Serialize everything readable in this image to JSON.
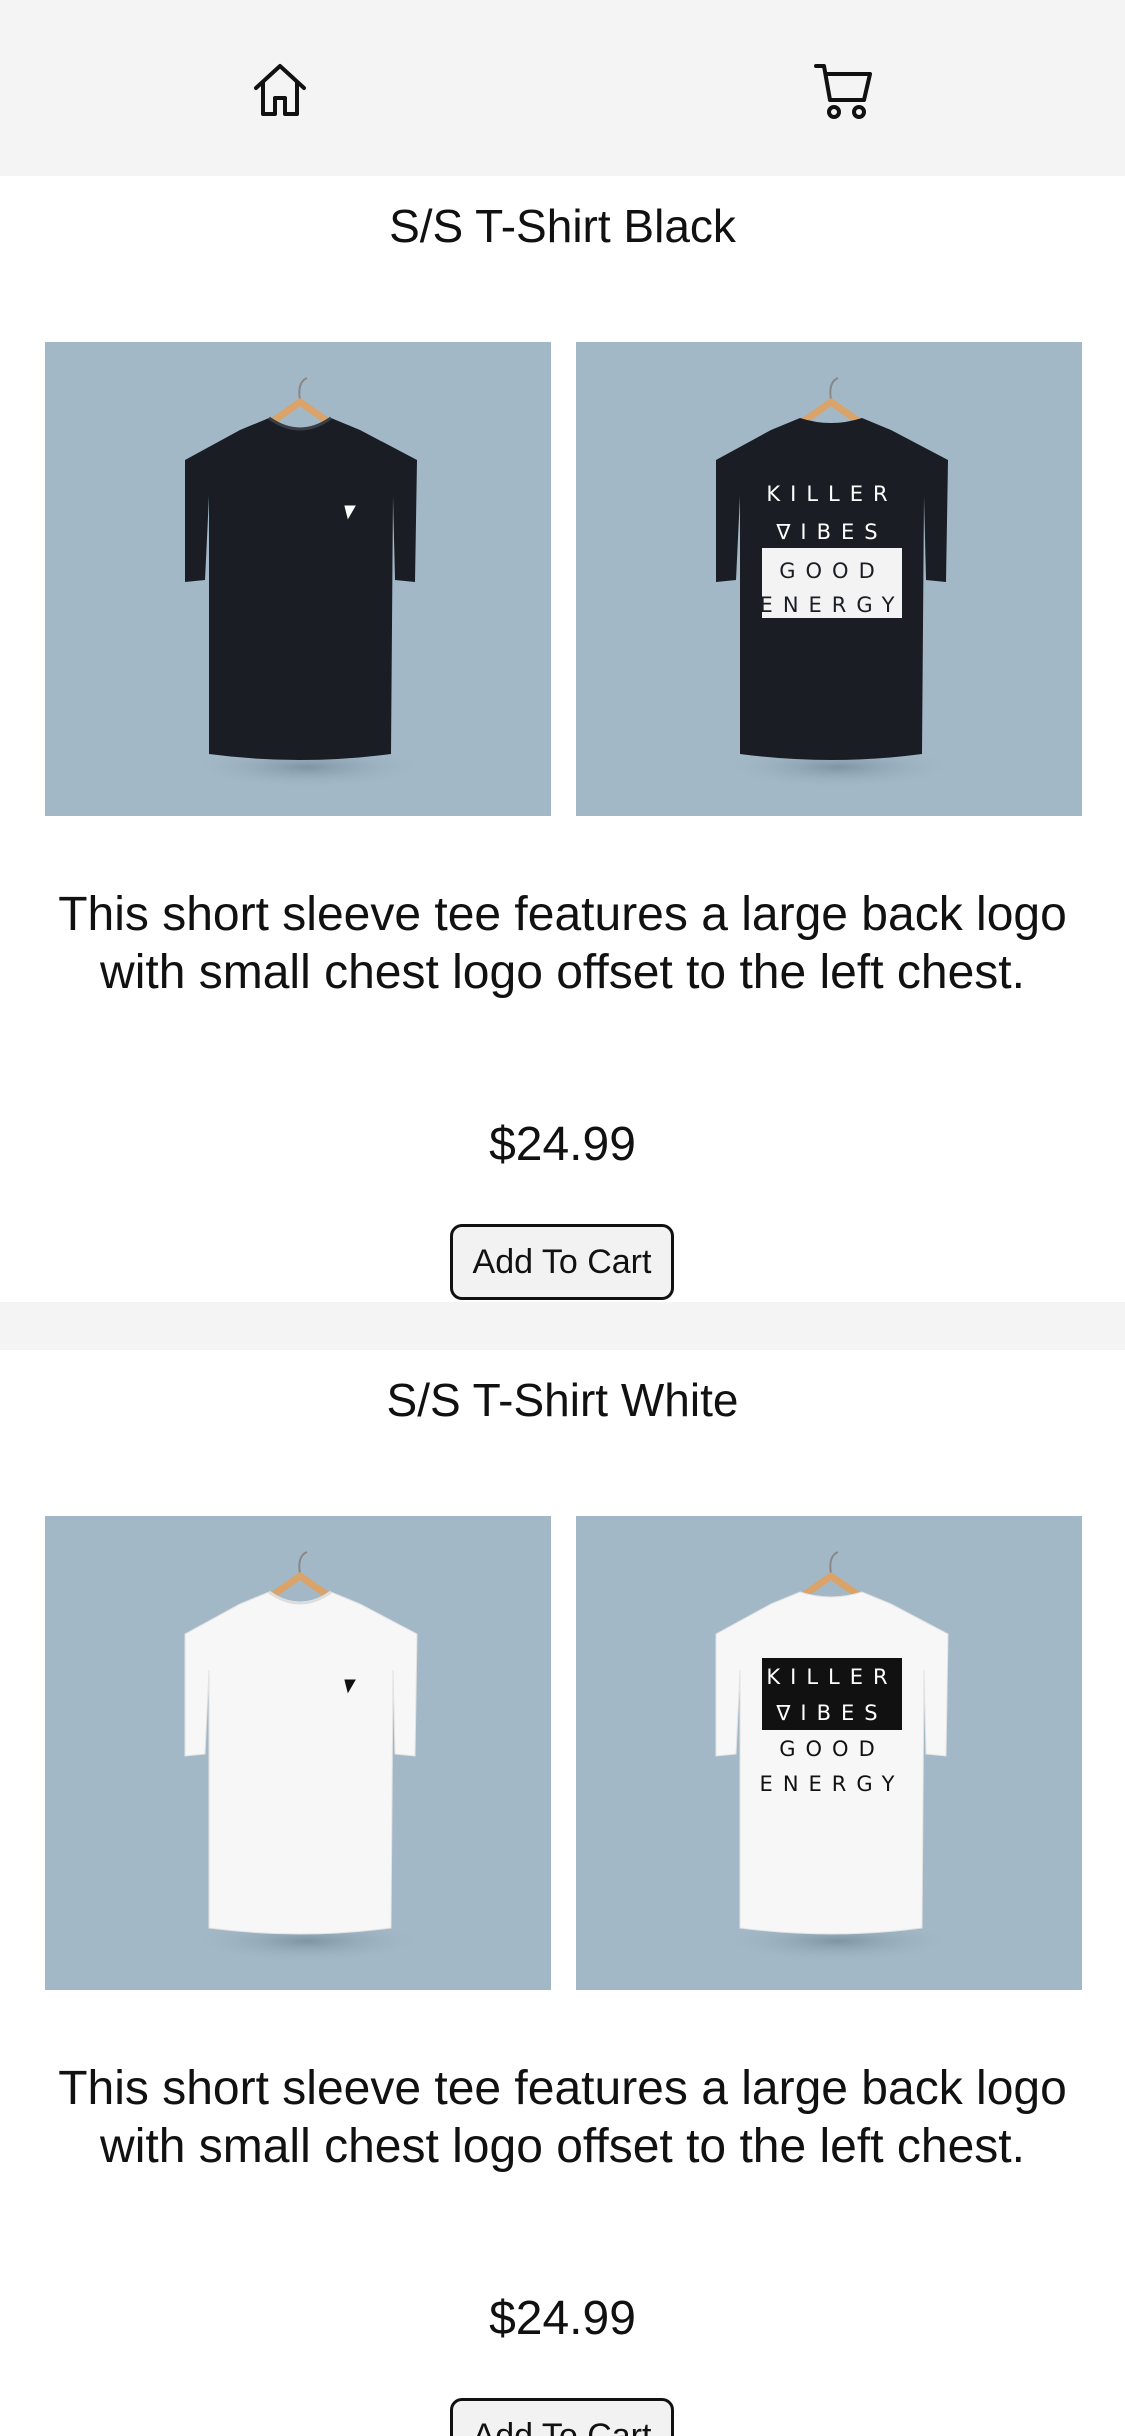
{
  "nav": {
    "home_icon": "home-icon",
    "cart_icon": "cart-icon"
  },
  "products": [
    {
      "title": "S/S T-Shirt Black",
      "shirt_color": "#1b1d24",
      "description": "This short sleeve tee features a large back logo with small chest logo offset to the left chest.",
      "price": "$24.99",
      "button_label": "Add To Cart",
      "back_print": [
        "KILLER",
        "∇IBES",
        "GOOD",
        "ENERGY"
      ]
    },
    {
      "title": "S/S T-Shirt White",
      "shirt_color": "#f7f7f7",
      "description": "This short sleeve tee features a large back logo with small chest logo offset to the left chest.",
      "price": "$24.99",
      "button_label": "Add To Cart",
      "back_print": [
        "KILLER",
        "∇IBES",
        "GOOD",
        "ENERGY"
      ]
    }
  ],
  "colors": {
    "header_bg": "#f4f4f4",
    "photo_bg": "#a3b8c7",
    "hanger": "#d9a36a"
  }
}
